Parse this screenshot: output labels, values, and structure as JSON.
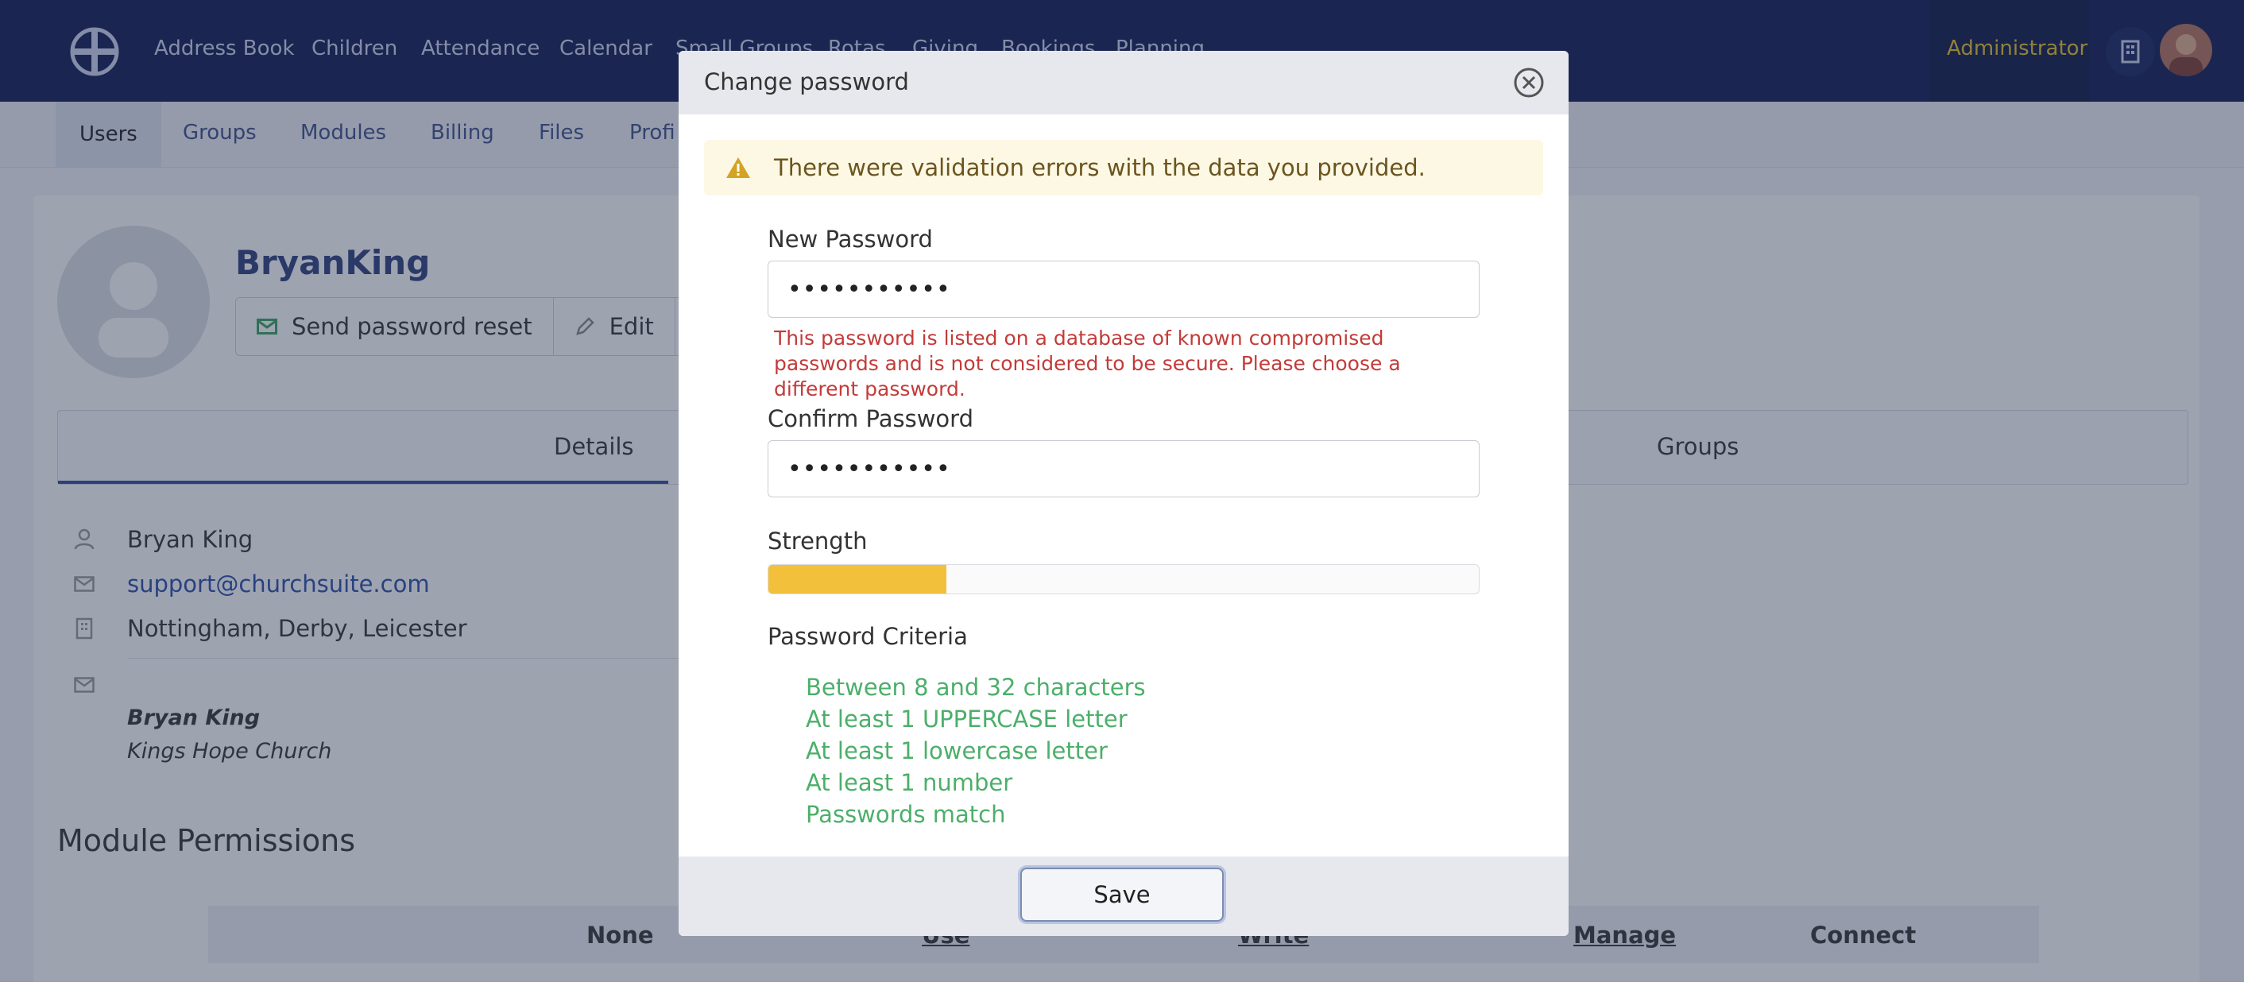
{
  "topnav": {
    "items": [
      "Address Book",
      "Children",
      "Attendance",
      "Calendar",
      "Small Groups",
      "Rotas",
      "Giving",
      "Bookings",
      "Planning"
    ],
    "admin_label": "Administrator"
  },
  "subnav": {
    "items": [
      "Users",
      "Groups",
      "Modules",
      "Billing",
      "Files",
      "Profi"
    ]
  },
  "profile": {
    "name": "BryanKing",
    "buttons": {
      "send_reset": "Send password reset",
      "edit": "Edit"
    }
  },
  "tabs": {
    "details": "Details",
    "groups": "Groups"
  },
  "details": {
    "full_name": "Bryan King",
    "email": "support@churchsuite.com",
    "location": "Nottingham, Derby, Leicester",
    "signature_name": "Bryan King",
    "signature_org": "Kings Hope Church"
  },
  "permissions": {
    "title": "Module Permissions",
    "columns": [
      "None",
      "Use",
      "Write",
      "Manage",
      "Connect"
    ]
  },
  "modal": {
    "title": "Change password",
    "alert": "There were validation errors with the data you provided.",
    "new_password_label": "New Password",
    "new_password_value": "•••••••••••",
    "error": "This password is listed on a database of known compromised passwords and is not considered to be secure. Please choose a different password.",
    "confirm_password_label": "Confirm Password",
    "confirm_password_value": "•••••••••••",
    "strength_label": "Strength",
    "strength_fraction": 0.25,
    "criteria_label": "Password Criteria",
    "criteria": [
      "Between 8 and 32 characters",
      "At least 1 UPPERCASE letter",
      "At least 1 lowercase letter",
      "At least 1 number",
      "Passwords match"
    ],
    "save_label": "Save"
  },
  "colors": {
    "nav_bg": "#0f1d52",
    "admin_text": "#e8c22b",
    "error_red": "#c33b39",
    "criteria_green": "#4caf6a",
    "strength_fill": "#f2c03a"
  }
}
